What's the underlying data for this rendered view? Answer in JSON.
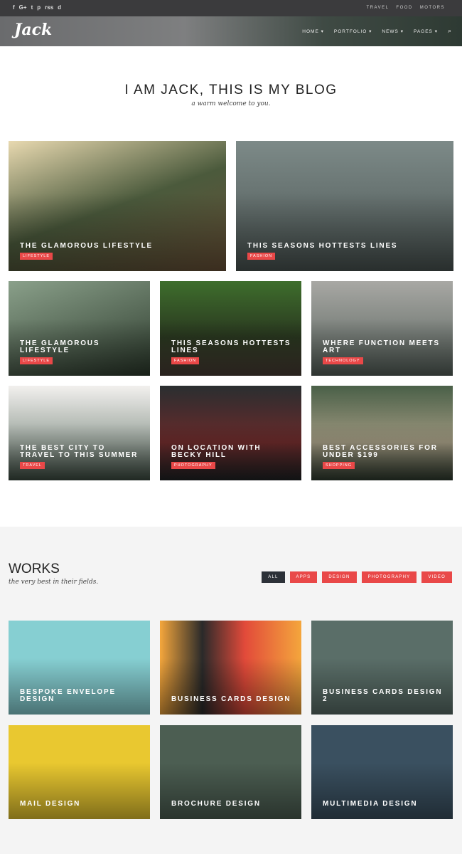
{
  "topbar": {
    "social": [
      "f",
      "G+",
      "t",
      "p",
      "rss",
      "d"
    ],
    "links": [
      "TRAVEL",
      "FOOD",
      "MOTORS"
    ]
  },
  "header": {
    "logo": "Jack",
    "nav": [
      "HOME ▾",
      "PORTFOLIO ▾",
      "NEWS ▾",
      "PAGES ▾"
    ],
    "search_icon": "⌕"
  },
  "hero": {
    "title": "I AM JACK, THIS IS MY BLOG",
    "subtitle": "a warm welcome to you."
  },
  "posts": [
    {
      "title": "The Glamorous Lifestyle",
      "tag": "LIFESTYLE"
    },
    {
      "title": "This Seasons Hottests Lines",
      "tag": "FASHION"
    },
    {
      "title": "The Glamorous Lifestyle",
      "tag": "LIFESTYLE"
    },
    {
      "title": "This Seasons Hottests Lines",
      "tag": "FASHION"
    },
    {
      "title": "Where Function Meets Art",
      "tag": "TECHNOLOGY"
    },
    {
      "title": "The Best City To Travel To This Summer",
      "tag": "TRAVEL"
    },
    {
      "title": "On Location With Becky Hill",
      "tag": "PHOTOGRAPHY"
    },
    {
      "title": "Best Accessories For Under $199",
      "tag": "SHOPPING"
    }
  ],
  "works": {
    "title": "WORKS",
    "subtitle": "the very best in their fields.",
    "filters": [
      "ALL",
      "APPS",
      "DESIGN",
      "PHOTOGRAPHY",
      "VIDEO"
    ],
    "items": [
      "Bespoke Envelope Design",
      "Business Cards Design",
      "Business Cards Design 2",
      "Mail Design",
      "Brochure Design",
      "Multimedia Design"
    ]
  }
}
